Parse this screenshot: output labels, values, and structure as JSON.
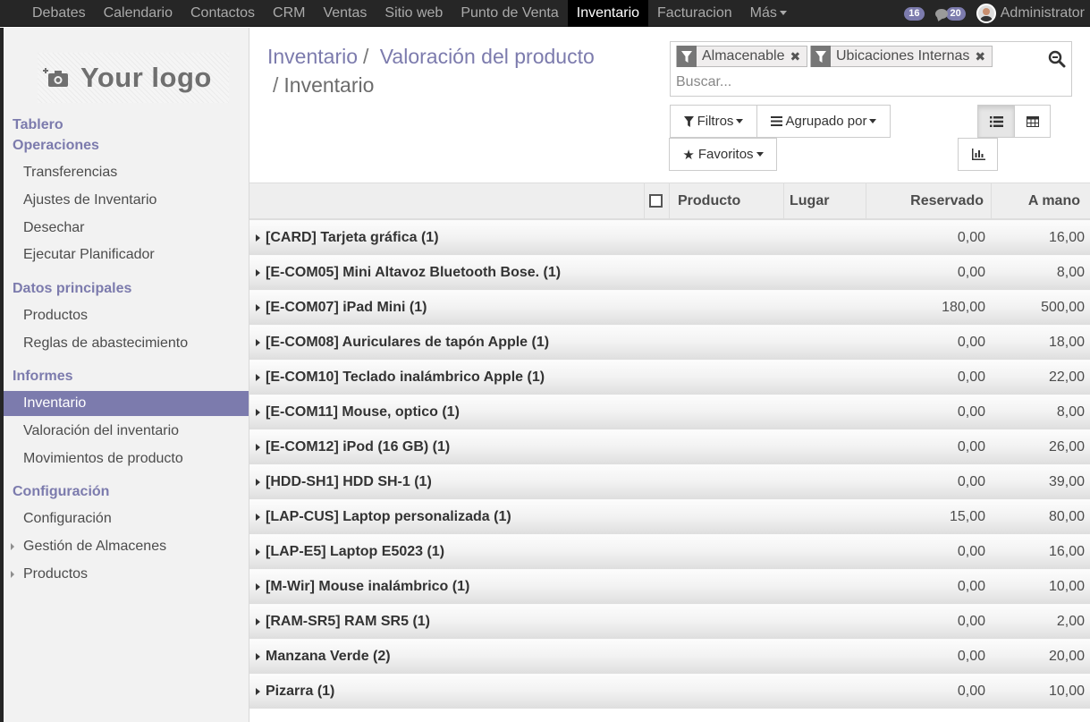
{
  "topnav": {
    "items": [
      "Debates",
      "Calendario",
      "Contactos",
      "CRM",
      "Ventas",
      "Sitio web",
      "Punto de Venta",
      "Inventario",
      "Facturacion",
      "Más"
    ],
    "active_index": 7,
    "badge_activities": "16",
    "badge_messages": "20",
    "user": "Administrator"
  },
  "sidebar": {
    "logo_text": "Your logo",
    "tablero": "Tablero",
    "operaciones": {
      "title": "Operaciones",
      "items": [
        "Transferencias",
        "Ajustes de Inventario",
        "Desechar",
        "Ejecutar Planificador"
      ]
    },
    "datos": {
      "title": "Datos principales",
      "items": [
        "Productos",
        "Reglas de abastecimiento"
      ]
    },
    "informes": {
      "title": "Informes",
      "items": [
        "Inventario",
        "Valoración del inventario",
        "Movimientos de producto"
      ]
    },
    "config": {
      "title": "Configuración",
      "items": [
        "Configuración",
        "Gestión de Almacenes",
        "Productos"
      ]
    }
  },
  "breadcrumb": {
    "parent": "Inventario",
    "middle": "Valoración del producto",
    "current": "Inventario"
  },
  "search": {
    "facets": [
      "Almacenable",
      "Ubicaciones Internas"
    ],
    "placeholder": "Buscar..."
  },
  "buttons": {
    "filters": "Filtros",
    "group_by": "Agrupado por",
    "favorites": "Favoritos"
  },
  "table": {
    "columns": [
      "Producto",
      "Lugar",
      "Reservado",
      "A mano"
    ],
    "rows": [
      {
        "name": "[CARD] Tarjeta gráfica (1)",
        "reserved": "0,00",
        "on_hand": "16,00"
      },
      {
        "name": "[E-COM05] Mini Altavoz Bluetooth Bose. (1)",
        "reserved": "0,00",
        "on_hand": "8,00"
      },
      {
        "name": "[E-COM07] iPad Mini (1)",
        "reserved": "180,00",
        "on_hand": "500,00"
      },
      {
        "name": "[E-COM08] Auriculares de tapón Apple (1)",
        "reserved": "0,00",
        "on_hand": "18,00"
      },
      {
        "name": "[E-COM10] Teclado inalámbrico Apple (1)",
        "reserved": "0,00",
        "on_hand": "22,00"
      },
      {
        "name": "[E-COM11] Mouse, optico (1)",
        "reserved": "0,00",
        "on_hand": "8,00"
      },
      {
        "name": "[E-COM12] iPod (16 GB) (1)",
        "reserved": "0,00",
        "on_hand": "26,00"
      },
      {
        "name": "[HDD-SH1] HDD SH-1 (1)",
        "reserved": "0,00",
        "on_hand": "39,00"
      },
      {
        "name": "[LAP-CUS] Laptop personalizada (1)",
        "reserved": "15,00",
        "on_hand": "80,00"
      },
      {
        "name": "[LAP-E5] Laptop E5023 (1)",
        "reserved": "0,00",
        "on_hand": "16,00"
      },
      {
        "name": "[M-Wir] Mouse inalámbrico (1)",
        "reserved": "0,00",
        "on_hand": "10,00"
      },
      {
        "name": "[RAM-SR5] RAM SR5 (1)",
        "reserved": "0,00",
        "on_hand": "2,00"
      },
      {
        "name": "Manzana Verde (2)",
        "reserved": "0,00",
        "on_hand": "20,00"
      },
      {
        "name": "Pizarra (1)",
        "reserved": "0,00",
        "on_hand": "10,00"
      }
    ]
  },
  "colors": {
    "brand": "#7c7bad",
    "navbar": "#262626"
  }
}
